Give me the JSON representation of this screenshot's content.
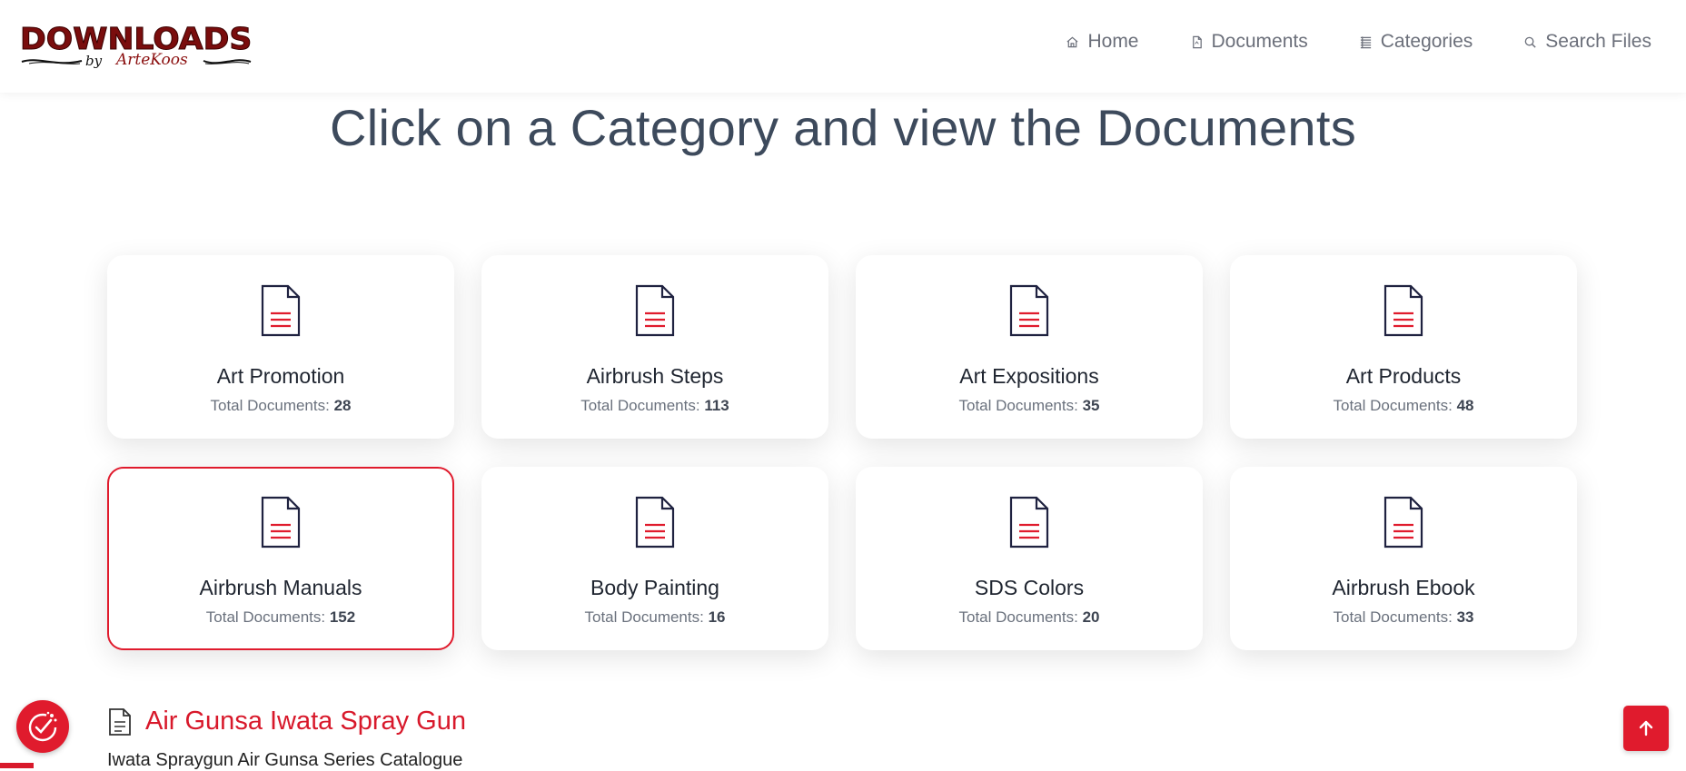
{
  "brand": {
    "logo_main": "DOWNLOADS",
    "logo_by": "by",
    "logo_name": "ArteKoos",
    "colors": {
      "logo": "#7a0d0d",
      "accent": "#e01b2d"
    }
  },
  "nav": {
    "items": [
      {
        "label": "Home",
        "icon": "home-icon"
      },
      {
        "label": "Documents",
        "icon": "file-icon"
      },
      {
        "label": "Categories",
        "icon": "list-icon"
      },
      {
        "label": "Search Files",
        "icon": "search-icon"
      }
    ]
  },
  "hero": {
    "title": "Click on a Category and view the Documents"
  },
  "categories": {
    "count_label": "Total Documents:",
    "items": [
      {
        "title": "Art Promotion",
        "count": "28"
      },
      {
        "title": "Airbrush Steps",
        "count": "113"
      },
      {
        "title": "Art Expositions",
        "count": "35"
      },
      {
        "title": "Art Products",
        "count": "48"
      },
      {
        "title": "Airbrush Manuals",
        "count": "152",
        "selected": true
      },
      {
        "title": "Body Painting",
        "count": "16"
      },
      {
        "title": "SDS Colors",
        "count": "20"
      },
      {
        "title": "Airbrush Ebook",
        "count": "33"
      }
    ]
  },
  "document": {
    "title": "Air Gunsa Iwata Spray Gun",
    "subtitle": "Iwata Spraygun Air Gunsa Series Catalogue",
    "icon": "document-icon"
  },
  "widgets": {
    "cookie_icon": "cookie-settings-icon",
    "top_icon": "arrow-up-icon"
  }
}
